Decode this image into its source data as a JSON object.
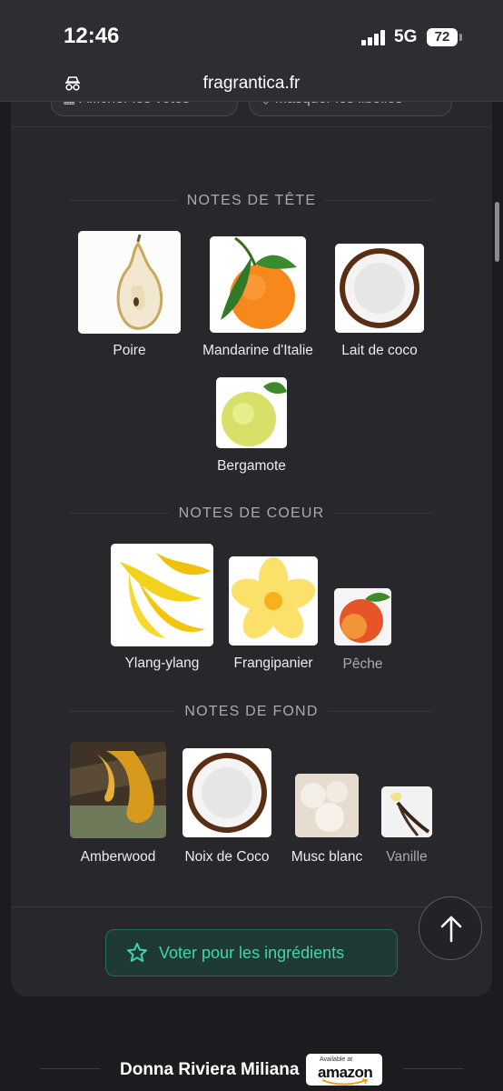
{
  "status_bar": {
    "time": "12:46",
    "network": "5G",
    "battery": "72"
  },
  "browser": {
    "url": "fragrantica.fr"
  },
  "toolbar": {
    "show_votes_label": "Afficher les votes",
    "hide_labels_label": "Masquer les libellés"
  },
  "pyramid": {
    "top_title": "NOTES DE TÊTE",
    "top_notes": [
      {
        "name": "Poire",
        "icon": "pear"
      },
      {
        "name": "Mandarine d'Italie",
        "icon": "mandarin"
      },
      {
        "name": "Lait de coco",
        "icon": "coconut"
      },
      {
        "name": "Bergamote",
        "icon": "bergamot"
      }
    ],
    "heart_title": "NOTES DE COEUR",
    "heart_notes": [
      {
        "name": "Ylang-ylang",
        "icon": "ylang-ylang"
      },
      {
        "name": "Frangipanier",
        "icon": "frangipani"
      },
      {
        "name": "Pêche",
        "icon": "peach"
      }
    ],
    "base_title": "NOTES DE FOND",
    "base_notes": [
      {
        "name": "Amberwood",
        "icon": "amberwood"
      },
      {
        "name": "Noix de Coco",
        "icon": "coconut"
      },
      {
        "name": "Musc blanc",
        "icon": "white-musk"
      },
      {
        "name": "Vanille",
        "icon": "vanilla"
      }
    ]
  },
  "vote_button": {
    "label": "Voter pour les ingrédients",
    "color": "#3ed6ad"
  },
  "footer": {
    "perfume_name": "Donna Riviera Miliana",
    "amazon_small": "Available at",
    "amazon_big": "amazon"
  }
}
